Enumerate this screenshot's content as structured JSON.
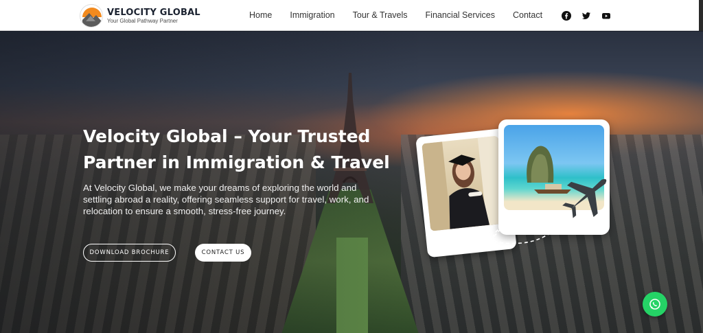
{
  "brand": {
    "name": "VELOCITY GLOBAL",
    "tagline": "Your Global Pathway Partner"
  },
  "nav": {
    "items": [
      {
        "label": "Home"
      },
      {
        "label": "Immigration"
      },
      {
        "label": "Tour & Travels"
      },
      {
        "label": "Financial Services"
      },
      {
        "label": "Contact"
      }
    ]
  },
  "social": {
    "icons": [
      "facebook-icon",
      "twitter-icon",
      "youtube-icon"
    ]
  },
  "hero": {
    "title": "Velocity Global – Your Trusted Partner in Immigration & Travel",
    "description": "At Velocity Global, we make your dreams of exploring the world and settling abroad a reality, offering seamless support for travel, work, and relocation to ensure a smooth, stress-free journey.",
    "primary_button": "DOWNLOAD BROCHURE",
    "secondary_button": "CONTACT US"
  },
  "colors": {
    "whatsapp": "#25d366",
    "header_bg": "#ffffff",
    "hero_text": "#ffffff"
  }
}
